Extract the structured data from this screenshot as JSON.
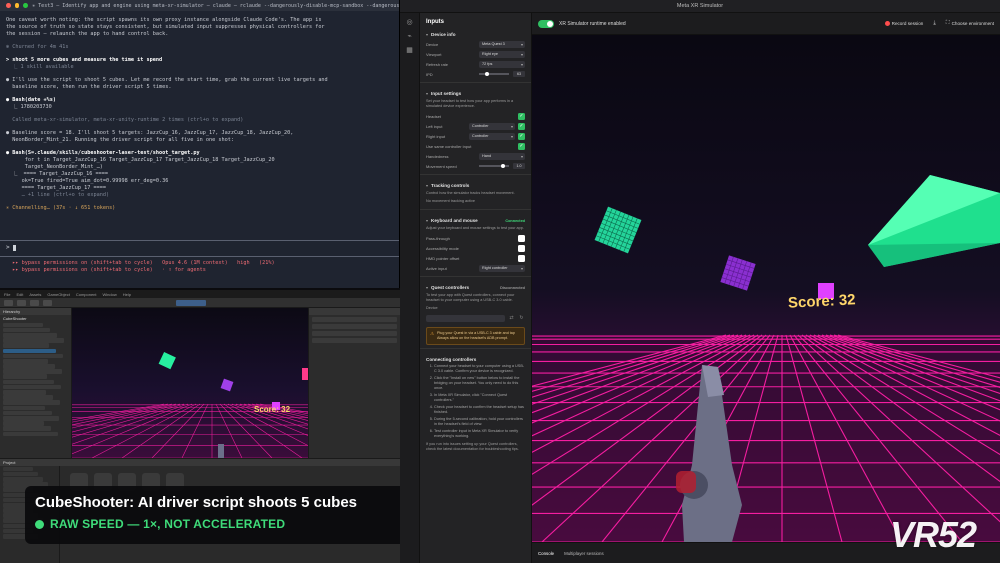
{
  "terminal": {
    "tab_text": "✳ Test3 — Identify app and engine using meta-xr-simulator — claude — rclaude --dangerously-disable-mcp-sandbox --dangerously-skip",
    "lines": [
      {
        "t": "One caveat worth noting: the script spawns its own proxy instance alongside Claude Code's. The app is",
        "c": "normal"
      },
      {
        "t": "the source of truth so state stays consistent, but simulated input suppresses physical controllers for",
        "c": "normal"
      },
      {
        "t": "the session — relaunch the app to hand control back.",
        "c": "normal"
      },
      {
        "t": "",
        "c": "gap"
      },
      {
        "t": "✻ Churned for 4m 41s",
        "c": "muted"
      },
      {
        "t": "",
        "c": "gap"
      },
      {
        "t": "> shoot 5 more cubes and measure the time it spend",
        "c": "bold"
      },
      {
        "t": "  ⎿ 1 skill available",
        "c": "muted"
      },
      {
        "t": "",
        "c": "gap"
      },
      {
        "t": "● I'll use the script to shoot 5 cubes. Let me record the start time, grab the current live targets and",
        "c": "normal"
      },
      {
        "t": "  baseline score, then run the driver script 5 times.",
        "c": "normal"
      },
      {
        "t": "",
        "c": "gap"
      },
      {
        "t": "● Bash(date +%s)",
        "c": "bold"
      },
      {
        "t": "  ⎿ 1780203730",
        "c": "normal"
      },
      {
        "t": "",
        "c": "gap"
      },
      {
        "t": "  Called meta-xr-simulator, meta-xr-unity-runtime 2 times (ctrl+o to expand)",
        "c": "muted"
      },
      {
        "t": "",
        "c": "gap"
      },
      {
        "t": "● Baseline score = 18. I'll shoot 5 targets: JazzCup_16, JazzCup_17, JazzCup_18, JazzCup_20,",
        "c": "normal"
      },
      {
        "t": "  NeonBorder_Mint_21. Running the driver script for all five in one shot:",
        "c": "normal"
      },
      {
        "t": "",
        "c": "gap"
      },
      {
        "t": "● Bash(S=.claude/skills/cubeshooter-laser-test/shoot_target.py",
        "c": "bold"
      },
      {
        "t": "      for t in Target_JazzCup_16 Target_JazzCup_17 Target_JazzCup_18 Target_JazzCup_20",
        "c": "normal"
      },
      {
        "t": "      Target_NeonBorder_Mint_…)",
        "c": "normal"
      },
      {
        "t": "  ⎿  ==== Target_JazzCup_16 ====",
        "c": "normal"
      },
      {
        "t": "     ok=True fired=True aim_dot=0.99998 err_deg=0.36",
        "c": "normal"
      },
      {
        "t": "     ==== Target_JazzCup_17 ====",
        "c": "normal"
      },
      {
        "t": "     … +1 line (ctrl+o to expand)",
        "c": "muted"
      },
      {
        "t": "",
        "c": "gap"
      },
      {
        "t": "✳ Channelling… (37s · ↓ 651 tokens)",
        "c": "accent"
      }
    ],
    "prompt_char": ">",
    "status_line_1": "  ▸▸ bypass permissions on (shift+tab to cycle)   Opus 4.6 (1M context)   high   (21%)",
    "status_line_2": "  ▸▸ bypass permissions on (shift+tab to cycle)   · ↑ for agents"
  },
  "unity": {
    "menu_items": [
      "File",
      "Edit",
      "Assets",
      "GameObject",
      "Component",
      "Window",
      "Help"
    ],
    "hierarchy_title": "Hierarchy",
    "hierarchy_root": "CubeShooter",
    "project_title": "Project",
    "console_title": "Console",
    "score_text": "Score: 32"
  },
  "caption": {
    "title": "CubeShooter: AI driver script shoots 5 cubes",
    "subtitle": "RAW SPEED — 1×, NOT ACCELERATED"
  },
  "simulator": {
    "window_title": "Meta XR Simulator",
    "inputs_title": "Inputs",
    "device_info": {
      "section": "Device info",
      "device_label": "Device",
      "device_value": "Meta Quest 3",
      "viewport_label": "Viewport",
      "viewport_value": "Right eye",
      "refresh_label": "Refresh rate",
      "refresh_value": "72 fps",
      "ipd_label": "IPD",
      "ipd_value": "63"
    },
    "input_settings": {
      "section": "Input settings",
      "desc": "Set your headset to test how your app performs in a simulated device experience.",
      "headset_label": "Headset",
      "left_label": "Left input",
      "left_value": "Controller",
      "right_label": "Right input",
      "right_value": "Controller",
      "use_label": "Use same controller input",
      "handedness_label": "Handedness",
      "handedness_value": "Hand",
      "movement_label": "Movement speed",
      "movement_value": "1.0"
    },
    "tracking": {
      "section": "Tracking controls",
      "desc": "Control how the simulator tracks headset movement.",
      "note": "No movement tracking active"
    },
    "keyboard": {
      "section": "Keyboard and mouse",
      "status": "Connected",
      "desc": "Adjust your keyboard and mouse settings to test your app.",
      "opt1": "Pass-through",
      "opt2": "Accessibility mode",
      "opt3": "HMD pointer offset",
      "active_label": "Active input",
      "active_value": "Right controller"
    },
    "quest": {
      "section": "Quest controllers",
      "status": "Disconnected",
      "desc": "To test your app with Quest controllers, connect your headset to your computer using a USB-C 3.0 cable.",
      "device_label": "Device",
      "warning": "Plug your Quest in via a USB-C 3 cable and tap Always allow on the headset's ADB prompt."
    },
    "connecting": {
      "section": "Connecting controllers",
      "steps": [
        "Connect your headset to your computer using a USB-C 3.0 cable. Confirm your device is recognized.",
        "Click the \"Install on new\" button below to install the bridging on your headset. You only need to do this once.",
        "In Meta XR Simulator, click \"Connect Quest controllers.\"",
        "Check your headset to confirm the headset setup has finished.",
        "During the 5-second calibration, hold your controllers in the headset's field of view.",
        "Test controller input in Meta XR Simulator to verify everything's working."
      ],
      "footer": "If you run into issues setting up your Quest controllers, check the latest documentation for troubleshooting tips."
    },
    "topbar": {
      "status": "XR Simulator runtime enabled",
      "record_label": "Record session",
      "env_label": "Choose environment"
    },
    "bottom_tabs": [
      "Console",
      "Multiplayer sessions"
    ],
    "score_text": "Score: 32"
  },
  "watermark": "VR52",
  "colors": {
    "accent_green": "#3fdc7a",
    "neon_grid": "#ff1fa6",
    "cube_mint": "#27f0a0",
    "cube_magenta": "#d040ff",
    "score_yellow": "#ffd66a"
  }
}
